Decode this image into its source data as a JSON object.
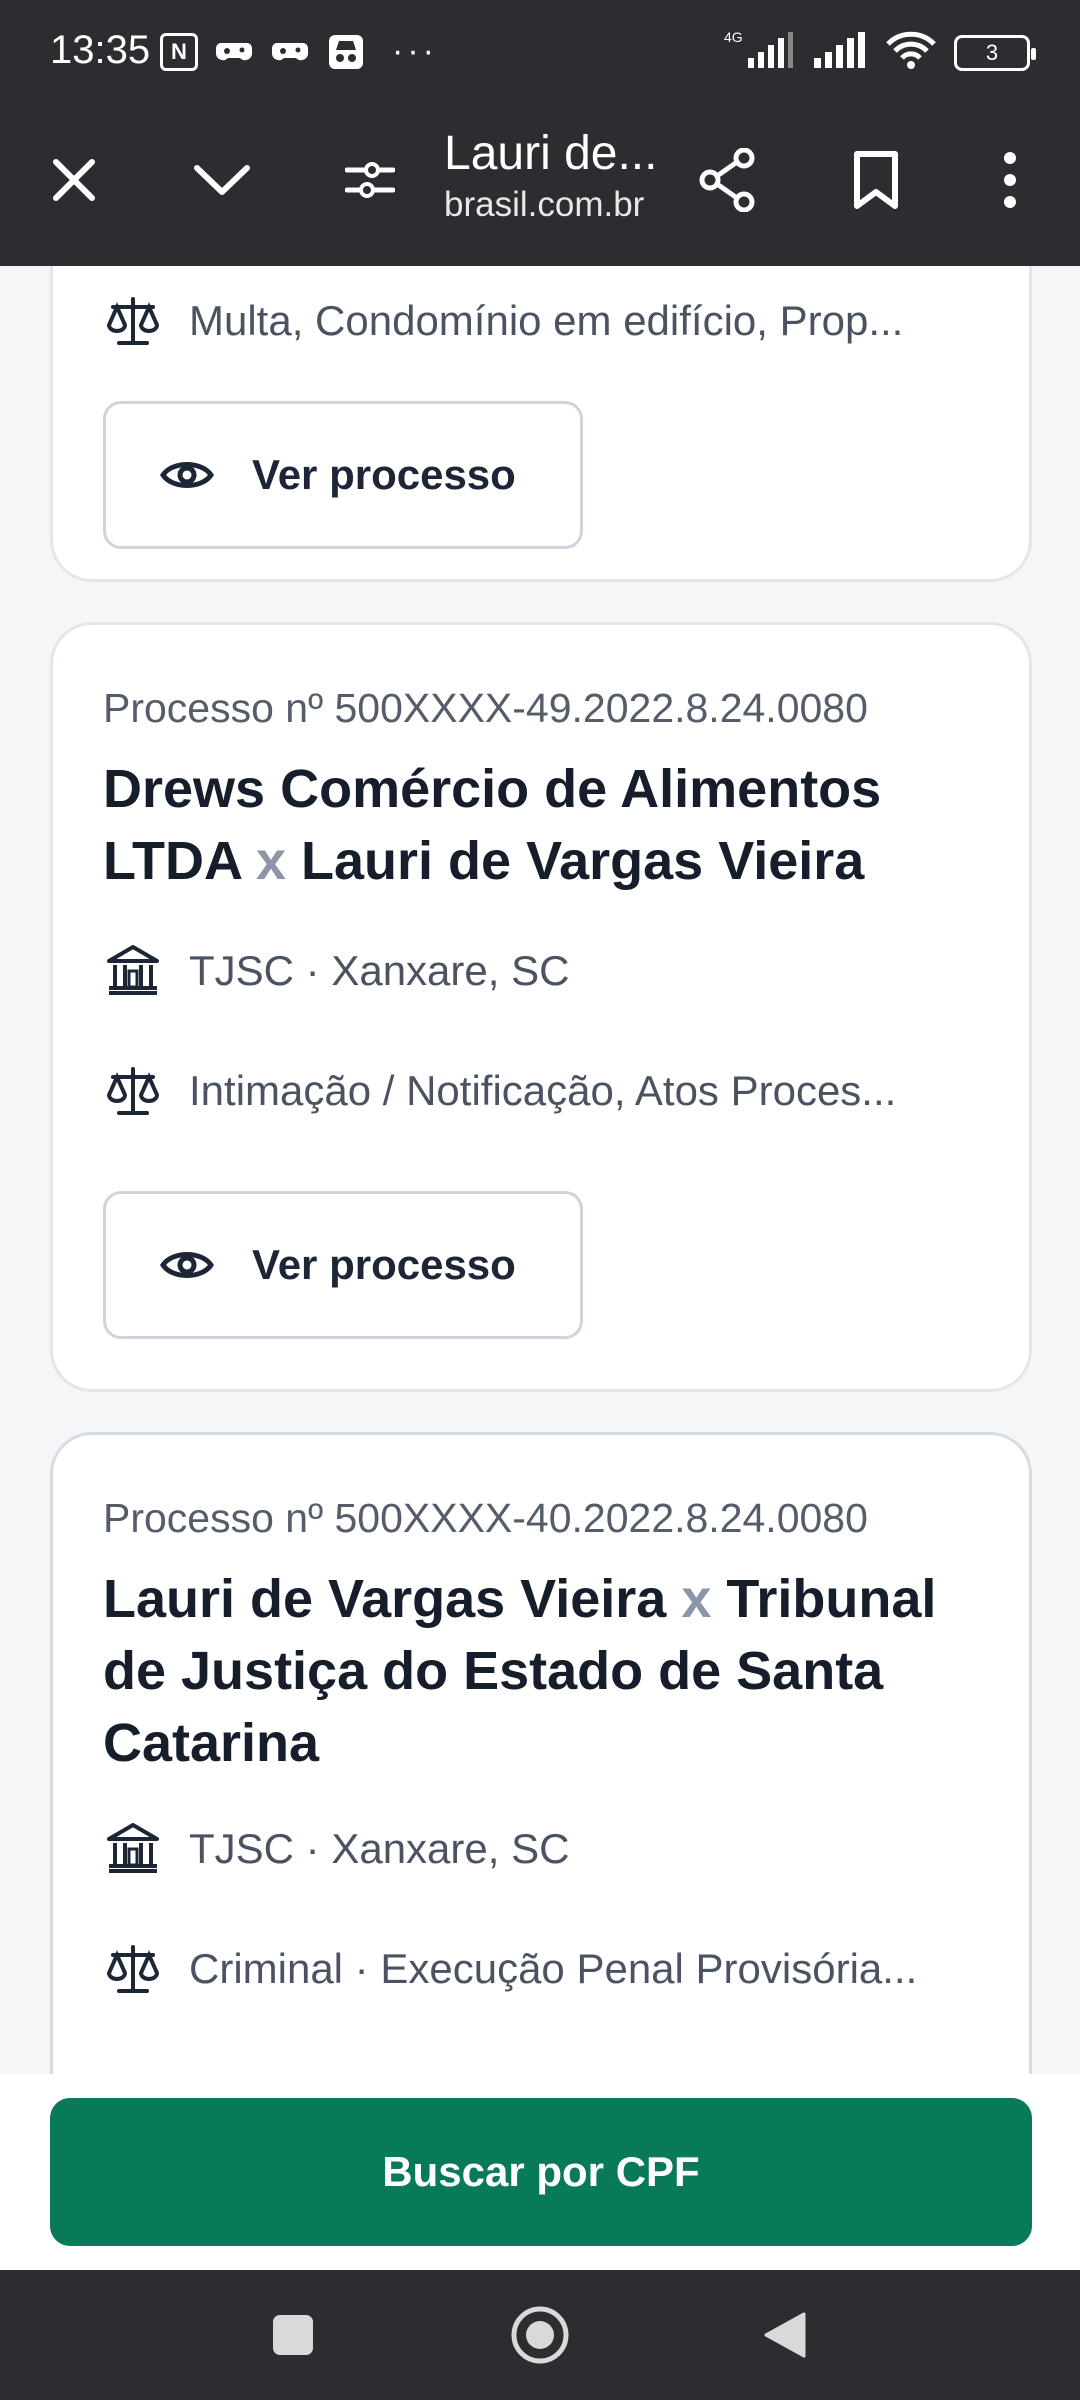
{
  "status_bar": {
    "time": "13:35",
    "network": "4G",
    "battery": "3",
    "more": "···"
  },
  "toolbar": {
    "title": "Lauri de...",
    "url": "brasil.com.br"
  },
  "cards": [
    {
      "subject": "Multa, Condomínio em edifício, Prop...",
      "button": "Ver processo"
    },
    {
      "process_number": "Processo nº 500XXXX-49.2022.8.24.0080",
      "party_a": "Drews Comércio de Alimentos LTDA",
      "versus": "x",
      "party_b": "Lauri de Vargas Vieira",
      "court": "TJSC · Xanxare, SC",
      "subject": "Intimação / Notificação, Atos Proces...",
      "button": "Ver processo"
    },
    {
      "process_number": "Processo nº 500XXXX-40.2022.8.24.0080",
      "party_a": "Lauri de Vargas Vieira",
      "versus": "x",
      "party_b": "Tribunal de Justiça do Estado de Santa Catarina",
      "court": "TJSC · Xanxare, SC",
      "subject": "Criminal · Execução Penal Provisória..."
    }
  ],
  "cta": {
    "label": "Buscar por CPF",
    "color": "#087a5a"
  }
}
